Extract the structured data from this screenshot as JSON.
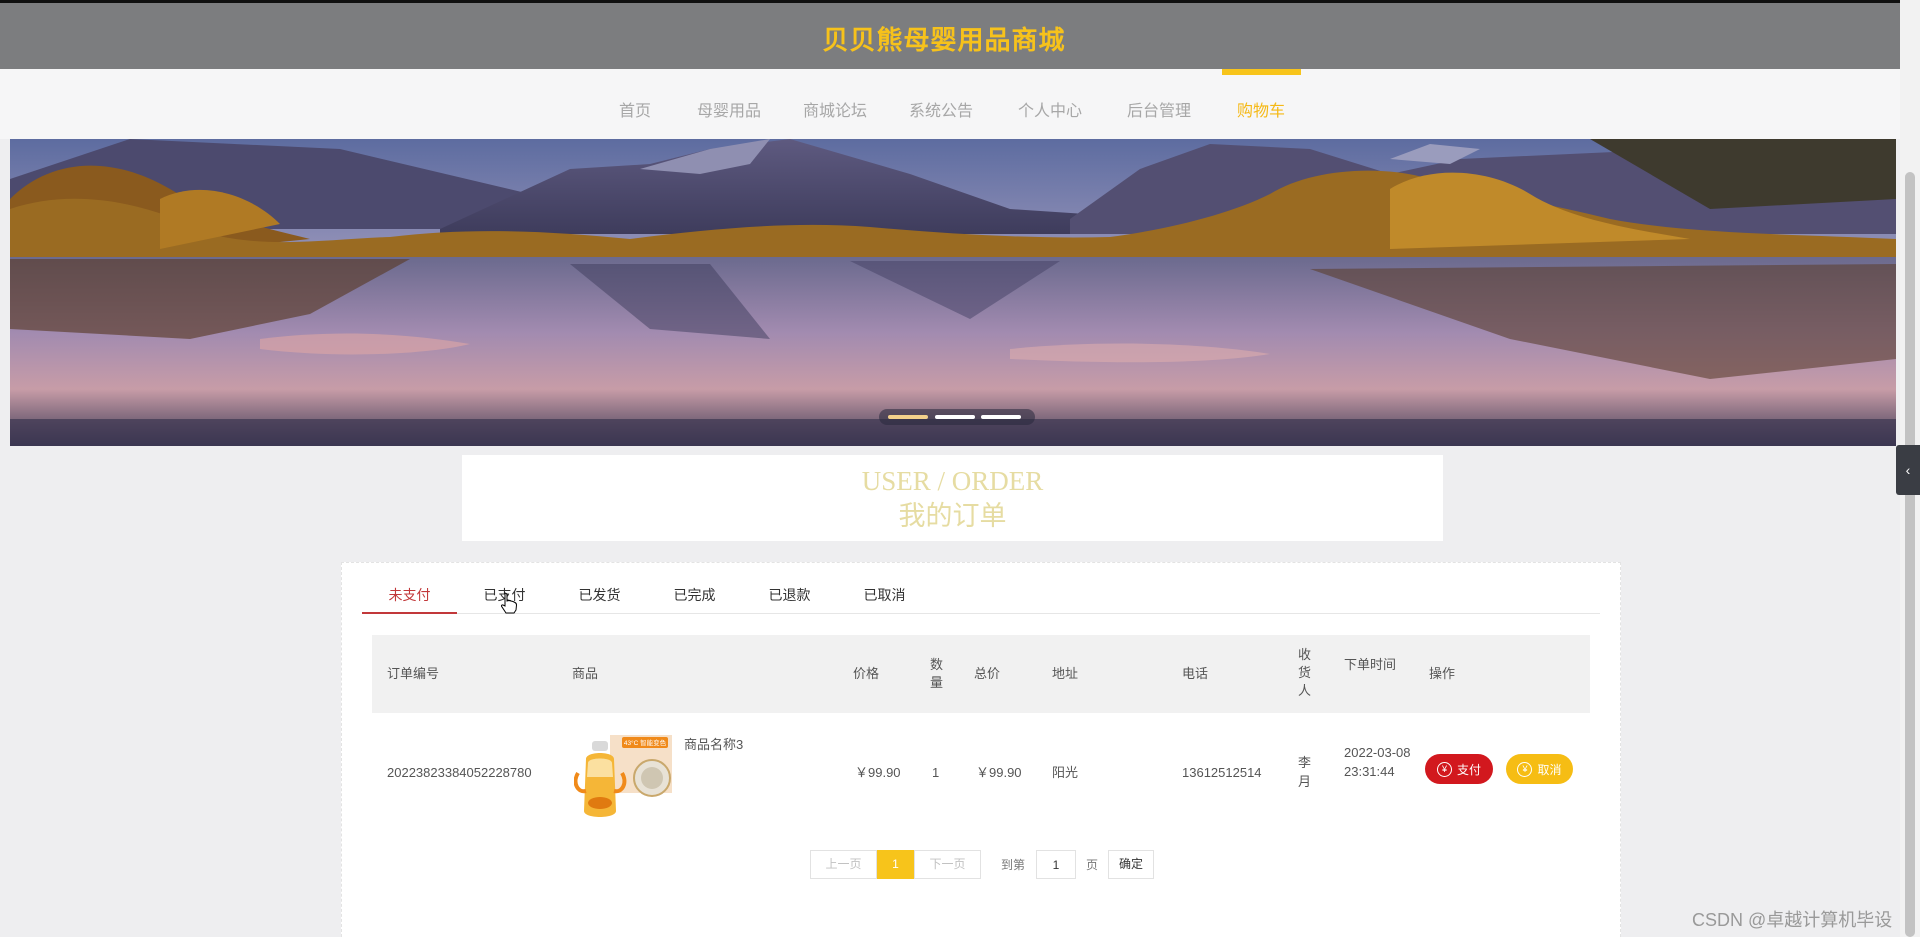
{
  "site": {
    "title": "贝贝熊母婴用品商城"
  },
  "nav": {
    "items": [
      {
        "label": "首页"
      },
      {
        "label": "母婴用品"
      },
      {
        "label": "商城论坛"
      },
      {
        "label": "系统公告"
      },
      {
        "label": "个人中心"
      },
      {
        "label": "后台管理"
      },
      {
        "label": "购物车"
      }
    ],
    "active_index": 6
  },
  "banner": {
    "slide_count": 3,
    "active_slide": 1
  },
  "section": {
    "title_en": "USER / ORDER",
    "title_cn": "我的订单"
  },
  "tabs": {
    "items": [
      {
        "label": "未支付"
      },
      {
        "label": "已支付"
      },
      {
        "label": "已发货"
      },
      {
        "label": "已完成"
      },
      {
        "label": "已退款"
      },
      {
        "label": "已取消"
      }
    ],
    "active_index": 0
  },
  "table": {
    "headers": {
      "order_no": "订单编号",
      "product": "商品",
      "price": "价格",
      "qty": "数量",
      "total": "总价",
      "address": "地址",
      "phone": "电话",
      "receiver": "收货人",
      "time": "下单时间",
      "actions": "操作"
    },
    "rows": [
      {
        "order_no": "20223823384052228780",
        "product_name": "商品名称3",
        "product_image_badge": "43°C 智能变色",
        "price": "￥99.90",
        "qty": "1",
        "total": "￥99.90",
        "address": "阳光",
        "phone": "13612512514",
        "receiver": "李月",
        "time": "2022-03-08 23:31:44",
        "pay_label": "支付",
        "cancel_label": "取消"
      }
    ]
  },
  "pagination": {
    "prev_label": "上一页",
    "current_page": "1",
    "next_label": "下一页",
    "goto_label": "到第",
    "goto_value": "1",
    "page_suffix": "页",
    "confirm_label": "确定"
  },
  "watermark": "CSDN @卓越计算机毕设",
  "colors": {
    "accent": "#f7c41b",
    "active_tab": "#c2383a",
    "pay_button": "#d2181e",
    "cancel_button": "#f6bd14",
    "topbar": "#7c7d7f"
  }
}
